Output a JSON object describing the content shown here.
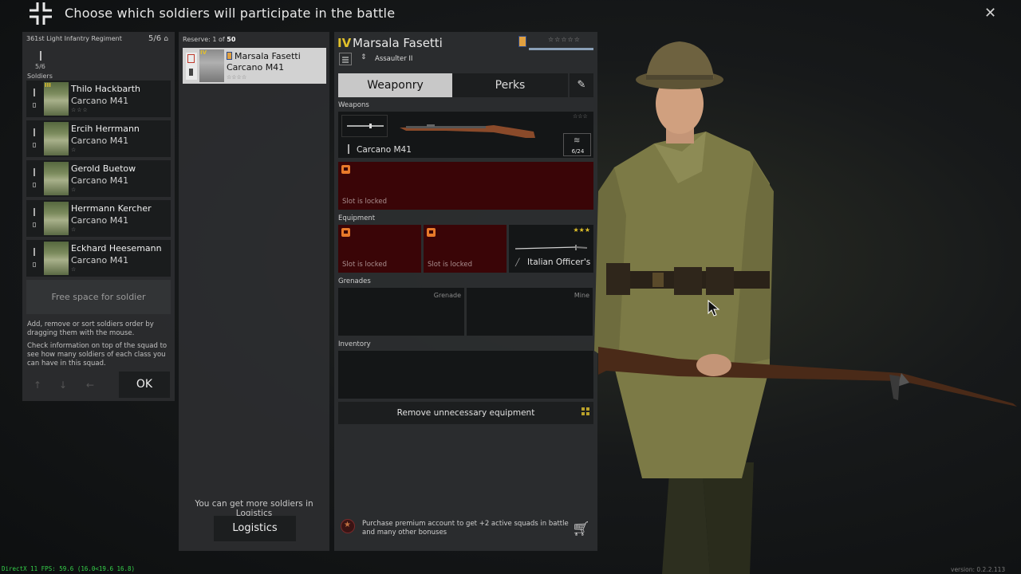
{
  "header": {
    "title": "Choose which soldiers will participate in the battle",
    "close_icon": "close-icon"
  },
  "squad": {
    "regiment": "361st Light Infantry Regiment",
    "count": "5/6",
    "class_count": "5/6",
    "soldiers_label": "Soldiers",
    "soldiers": [
      {
        "rank": "III",
        "name": "Thilo Hackbarth",
        "weapon": "Carcano M41",
        "stars": "☆☆☆"
      },
      {
        "rank": "",
        "name": "Ercih Herrmann",
        "weapon": "Carcano M41",
        "stars": "☆"
      },
      {
        "rank": "",
        "name": "Gerold Buetow",
        "weapon": "Carcano M41",
        "stars": "☆"
      },
      {
        "rank": "",
        "name": "Herrmann Kercher",
        "weapon": "Carcano M41",
        "stars": "☆"
      },
      {
        "rank": "",
        "name": "Eckhard Heesemann",
        "weapon": "Carcano M41",
        "stars": "☆"
      }
    ],
    "free_space": "Free space for soldier",
    "hint1": "Add, remove or sort soldiers order by dragging them with the mouse.",
    "hint2": "Check information on top of the squad to see how many soldiers of each class you can have in this squad.",
    "ok_label": "OK"
  },
  "reserve": {
    "label_prefix": "Reserve: 1 of ",
    "label_total": "50",
    "card": {
      "rank": "IV",
      "name": "Marsala Fasetti",
      "weapon": "Carcano M41",
      "stars": "☆☆☆☆"
    },
    "more_text": "You can get more soldiers in Logistics",
    "logistics_label": "Logistics"
  },
  "detail": {
    "rank": "IV",
    "name": "Marsala Fasetti",
    "stars": "☆☆☆☆☆",
    "class_name": "Assaulter II",
    "tabs": {
      "weaponry": "Weaponry",
      "perks": "Perks"
    },
    "weapons_label": "Weapons",
    "weapon": {
      "name": "Carcano M41",
      "ammo": "6/24",
      "stars": "☆☆☆"
    },
    "slot_locked": "Slot is locked",
    "equipment_label": "Equipment",
    "officer_item": {
      "name": "Italian Officer's",
      "stars": "★★★"
    },
    "grenades_label": "Grenades",
    "grenade_slot": "Grenade",
    "mine_slot": "Mine",
    "inventory_label": "Inventory",
    "remove_label": "Remove unnecessary equipment",
    "premium_text": "Purchase premium account to get +2 active squads in battle and many other bonuses"
  },
  "footer": {
    "fps": "DirectX 11 FPS: 59.6 (16.0<19.6 16.8)",
    "version": "version: 0.2.2.113"
  },
  "colors": {
    "rank_gold": "#e0c02a",
    "locked_red": "#3a0507",
    "lock_orange": "#e87a2a",
    "fps_green": "#35d04a"
  }
}
